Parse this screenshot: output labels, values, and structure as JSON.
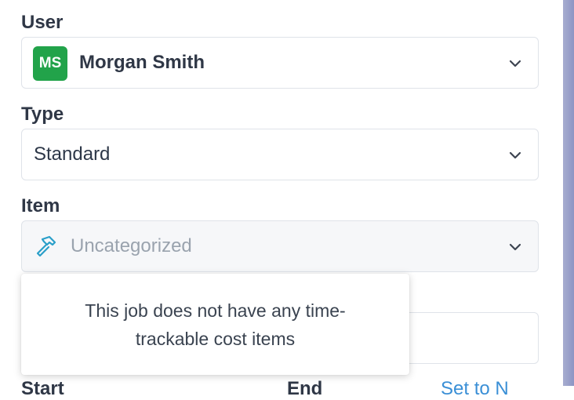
{
  "user": {
    "label": "User",
    "initials": "MS",
    "name": "Morgan Smith",
    "avatar_color": "#22a34a"
  },
  "type": {
    "label": "Type",
    "value": "Standard"
  },
  "item": {
    "label": "Item",
    "placeholder": "Uncategorized",
    "icon": "hammer-icon"
  },
  "popover": {
    "message": "This job does not have any time-trackable cost items"
  },
  "bottom": {
    "start_label": "Start",
    "end_label": "End",
    "set_link": "Set to N"
  }
}
